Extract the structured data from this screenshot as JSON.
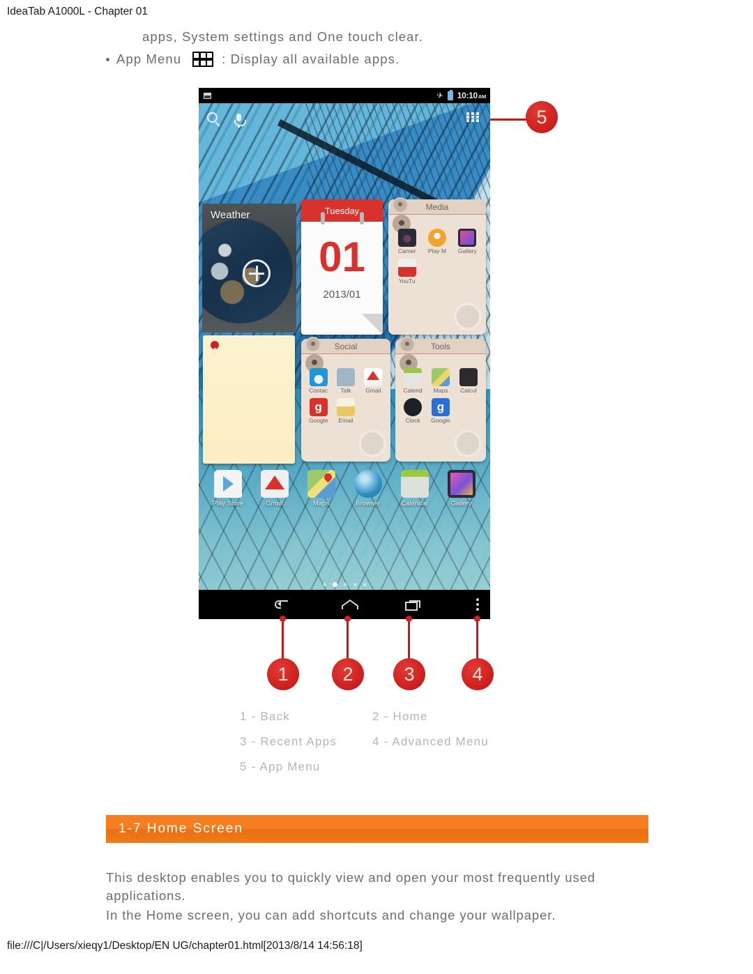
{
  "page": {
    "header": "IdeaTab A1000L - Chapter 01",
    "footer": "file:///C|/Users/xieqy1/Desktop/EN UG/chapter01.html[2013/8/14 14:56:18]"
  },
  "intro": {
    "line1": "apps, System settings and One touch clear.",
    "bullet_label": "App Menu",
    "bullet_rest": ": Display all available apps.",
    "icon": "app-grid-icon"
  },
  "tablet": {
    "status_bar": {
      "left_icon": "screenshot-icon",
      "airplane_icon": "airplane-mode-icon",
      "battery_icon": "battery-icon",
      "time": "10:10",
      "ampm": "AM"
    },
    "search_row": {
      "search_icon": "search-icon",
      "mic_icon": "microphone-icon",
      "app_menu_icon": "app-grid-icon"
    },
    "weather_widget": {
      "title": "Weather",
      "add_icon": "plus-circle-icon"
    },
    "calendar_widget": {
      "weekday": "Tuesday",
      "day": "01",
      "date": "2013/01"
    },
    "note_widget": {
      "pin_icon": "pushpin-icon"
    },
    "folders": [
      {
        "name": "Media",
        "apps": [
          {
            "label": "Camer",
            "icon": "camera-icon",
            "color": "#3a3a42"
          },
          {
            "label": "Play M",
            "icon": "play-music-icon",
            "color": "#f2a32b"
          },
          {
            "label": "Gallery",
            "icon": "gallery-icon",
            "color": "#2a2a33"
          },
          {
            "label": "YouTu",
            "icon": "youtube-icon",
            "color": "#d8322c"
          }
        ]
      },
      {
        "name": "Social",
        "apps": [
          {
            "label": "Contac",
            "icon": "contacts-icon",
            "color": "#2196d4"
          },
          {
            "label": "Talk",
            "icon": "talk-icon",
            "color": "#8fa9bf"
          },
          {
            "label": "Gmail",
            "icon": "gmail-icon",
            "color": "#e8e8e8"
          },
          {
            "label": "Google",
            "icon": "google-plus-icon",
            "color": "#d8322c"
          },
          {
            "label": "Email",
            "icon": "email-icon",
            "color": "#e7c96a"
          }
        ]
      },
      {
        "name": "Tools",
        "apps": [
          {
            "label": "Calend",
            "icon": "calendar-icon",
            "color": "#cfd4cf"
          },
          {
            "label": "Maps",
            "icon": "maps-icon",
            "color": "#9dc96a"
          },
          {
            "label": "Calcul",
            "icon": "calculator-icon",
            "color": "#2b2b2b"
          },
          {
            "label": "Clock",
            "icon": "clock-icon",
            "color": "#1d2026"
          },
          {
            "label": "Google",
            "icon": "google-search-icon",
            "color": "#2a6fd4"
          }
        ]
      }
    ],
    "dock": [
      {
        "label": "Play Store",
        "icon": "play-store-icon",
        "color": "#f2f2f2"
      },
      {
        "label": "Gmail",
        "icon": "gmail-icon",
        "color": "#eeeeee"
      },
      {
        "label": "Maps",
        "icon": "maps-icon",
        "color": "#9dc96a"
      },
      {
        "label": "Browser",
        "icon": "browser-globe-icon",
        "color": "#2f8fc4"
      },
      {
        "label": "Calendar",
        "icon": "calendar-icon",
        "color": "#cdd2cd"
      },
      {
        "label": "Gallery",
        "icon": "gallery-icon",
        "color": "#2a2a33"
      }
    ],
    "page_dots": {
      "count": 5,
      "active_index": 1
    },
    "nav_bar": [
      {
        "name": "back-icon"
      },
      {
        "name": "home-icon"
      },
      {
        "name": "recent-apps-icon"
      },
      {
        "name": "advanced-menu-icon"
      }
    ]
  },
  "callouts": [
    {
      "number": "1"
    },
    {
      "number": "2"
    },
    {
      "number": "3"
    },
    {
      "number": "4"
    },
    {
      "number": "5"
    }
  ],
  "legend": {
    "rows": [
      {
        "left": "1 - Back",
        "right": "2 - Home"
      },
      {
        "left": "3 - Recent Apps",
        "right": "4 - Advanced Menu"
      },
      {
        "left": "5 - App Menu",
        "right": ""
      }
    ]
  },
  "section": {
    "title": "1-7 Home Screen",
    "accent": "#f57f20"
  },
  "body": {
    "para1": "This desktop enables you to quickly view and open your most frequently used applications.",
    "para2": "In the Home screen, you can add shortcuts and change your wallpaper."
  }
}
